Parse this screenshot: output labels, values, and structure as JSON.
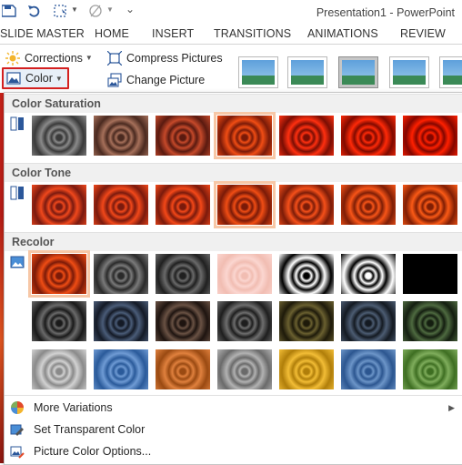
{
  "window": {
    "title": "Presentation1 - PowerPoint"
  },
  "tabs": [
    "SLIDE MASTER",
    "HOME",
    "INSERT",
    "TRANSITIONS",
    "ANIMATIONS",
    "REVIEW"
  ],
  "ribbon": {
    "corrections_label": "Corrections",
    "color_label": "Color",
    "compress_label": "Compress Pictures",
    "change_label": "Change Picture"
  },
  "panel": {
    "saturation_title": "Color Saturation",
    "tone_title": "Color Tone",
    "recolor_title": "Recolor",
    "saturation": [
      {
        "name": "saturation-0",
        "colors": [
          "#8a8a8a",
          "#3a3a3a"
        ]
      },
      {
        "name": "saturation-33",
        "colors": [
          "#a6705a",
          "#4a2a20"
        ]
      },
      {
        "name": "saturation-66",
        "colors": [
          "#c5492a",
          "#5a1a10"
        ]
      },
      {
        "name": "saturation-100",
        "colors": [
          "#f04d14",
          "#7a1a08"
        ]
      },
      {
        "name": "saturation-200",
        "colors": [
          "#ff3010",
          "#7a0e04"
        ]
      },
      {
        "name": "saturation-300",
        "colors": [
          "#ff2a08",
          "#800a00"
        ]
      },
      {
        "name": "saturation-400",
        "colors": [
          "#ff2000",
          "#820600"
        ]
      }
    ],
    "tone": [
      {
        "name": "temperature-4700",
        "colors": [
          "#f0481c",
          "#7a1a10"
        ]
      },
      {
        "name": "temperature-5300",
        "colors": [
          "#f2481a",
          "#7a1a0e"
        ]
      },
      {
        "name": "temperature-5900",
        "colors": [
          "#f44818",
          "#7a1a0c"
        ]
      },
      {
        "name": "temperature-6500",
        "colors": [
          "#f04d14",
          "#7a1a08"
        ]
      },
      {
        "name": "temperature-7200",
        "colors": [
          "#f5501a",
          "#7c1c08"
        ]
      },
      {
        "name": "temperature-7800",
        "colors": [
          "#f85518",
          "#7e1e06"
        ]
      },
      {
        "name": "temperature-8800",
        "colors": [
          "#fb5a16",
          "#801e04"
        ]
      }
    ],
    "recolor": [
      {
        "name": "no-recolor",
        "colors": [
          "#f04d14",
          "#7a1a08"
        ]
      },
      {
        "name": "grayscale",
        "colors": [
          "#7a7a7a",
          "#2a2a2a"
        ]
      },
      {
        "name": "sepia",
        "colors": [
          "#6a6a6a",
          "#202020"
        ]
      },
      {
        "name": "washout",
        "colors": [
          "#fbd6d0",
          "#f1bdb2"
        ]
      },
      {
        "name": "black-white-25",
        "colors": [
          "#ffffff",
          "#000000"
        ]
      },
      {
        "name": "black-white-50",
        "colors": [
          "#000000",
          "#ffffff"
        ]
      },
      {
        "name": "black-white-75",
        "colors": [
          "#000000",
          "#000000"
        ]
      },
      {
        "name": "accent1-dark",
        "colors": [
          "#6a6a6a",
          "#1a1a1a"
        ]
      },
      {
        "name": "accent2-dark",
        "colors": [
          "#4a5c78",
          "#141a26"
        ]
      },
      {
        "name": "accent3-dark",
        "colors": [
          "#6a5244",
          "#1e1410"
        ]
      },
      {
        "name": "accent4-dark",
        "colors": [
          "#6e6e6e",
          "#1e1e1e"
        ]
      },
      {
        "name": "accent5-dark",
        "colors": [
          "#6a6030",
          "#1e1a0a"
        ]
      },
      {
        "name": "accent6-dark",
        "colors": [
          "#4c5c72",
          "#141a22"
        ]
      },
      {
        "name": "accent7-dark",
        "colors": [
          "#4e6a40",
          "#141e10"
        ]
      },
      {
        "name": "accent1-light",
        "colors": [
          "#d2d2d2",
          "#8a8a8a"
        ]
      },
      {
        "name": "accent2-light",
        "colors": [
          "#6f9bd4",
          "#2a5a9a"
        ]
      },
      {
        "name": "accent3-light",
        "colors": [
          "#e0813e",
          "#9a4a12"
        ]
      },
      {
        "name": "accent4-light",
        "colors": [
          "#b2b2b2",
          "#6a6a6a"
        ]
      },
      {
        "name": "accent5-light",
        "colors": [
          "#f2bd36",
          "#b07e0a"
        ]
      },
      {
        "name": "accent6-light",
        "colors": [
          "#6c95c8",
          "#2c5690"
        ]
      },
      {
        "name": "accent7-light",
        "colors": [
          "#7fad5c",
          "#3e6e22"
        ]
      }
    ],
    "more_variations": "More Variations",
    "set_transparent": "Set Transparent Color",
    "color_options": "Picture Color Options..."
  }
}
